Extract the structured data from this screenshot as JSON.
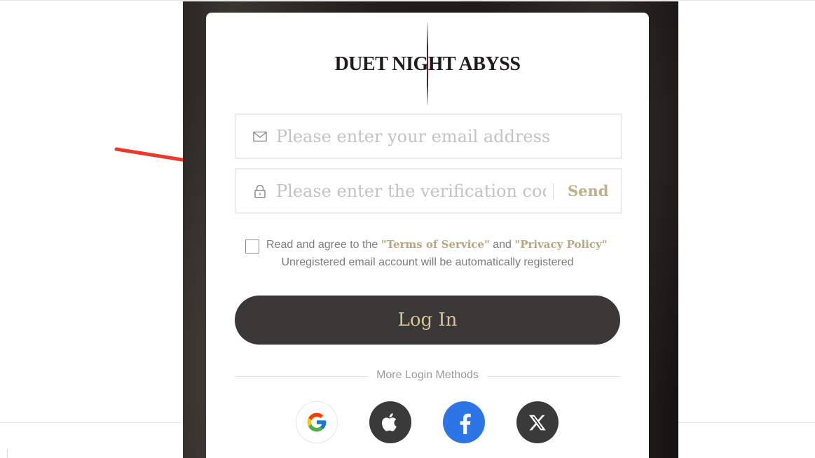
{
  "brand": {
    "logo_text": "DUET NIGHT ABYSS"
  },
  "form": {
    "email_placeholder": "Please enter your email address",
    "code_placeholder": "Please enter the verification cod",
    "send_label": "Send",
    "email_icon": "envelope-icon",
    "code_icon": "lock-icon"
  },
  "agreement": {
    "prefix": "Read and agree to the ",
    "terms_link": "\"Terms of Service\"",
    "and": " and ",
    "privacy_link": "\"Privacy Policy\"",
    "note": "Unregistered email account will be automatically registered",
    "checked": false
  },
  "login_button": "Log In",
  "more_methods_label": "More Login Methods",
  "social_methods": [
    "google-icon",
    "apple-icon",
    "facebook-icon",
    "x-icon"
  ],
  "colors": {
    "accent_gold": "#bfb08d",
    "button_dark": "#3a3836",
    "facebook_blue": "#2d74e6",
    "annotation_arrow": "#e8392b"
  }
}
